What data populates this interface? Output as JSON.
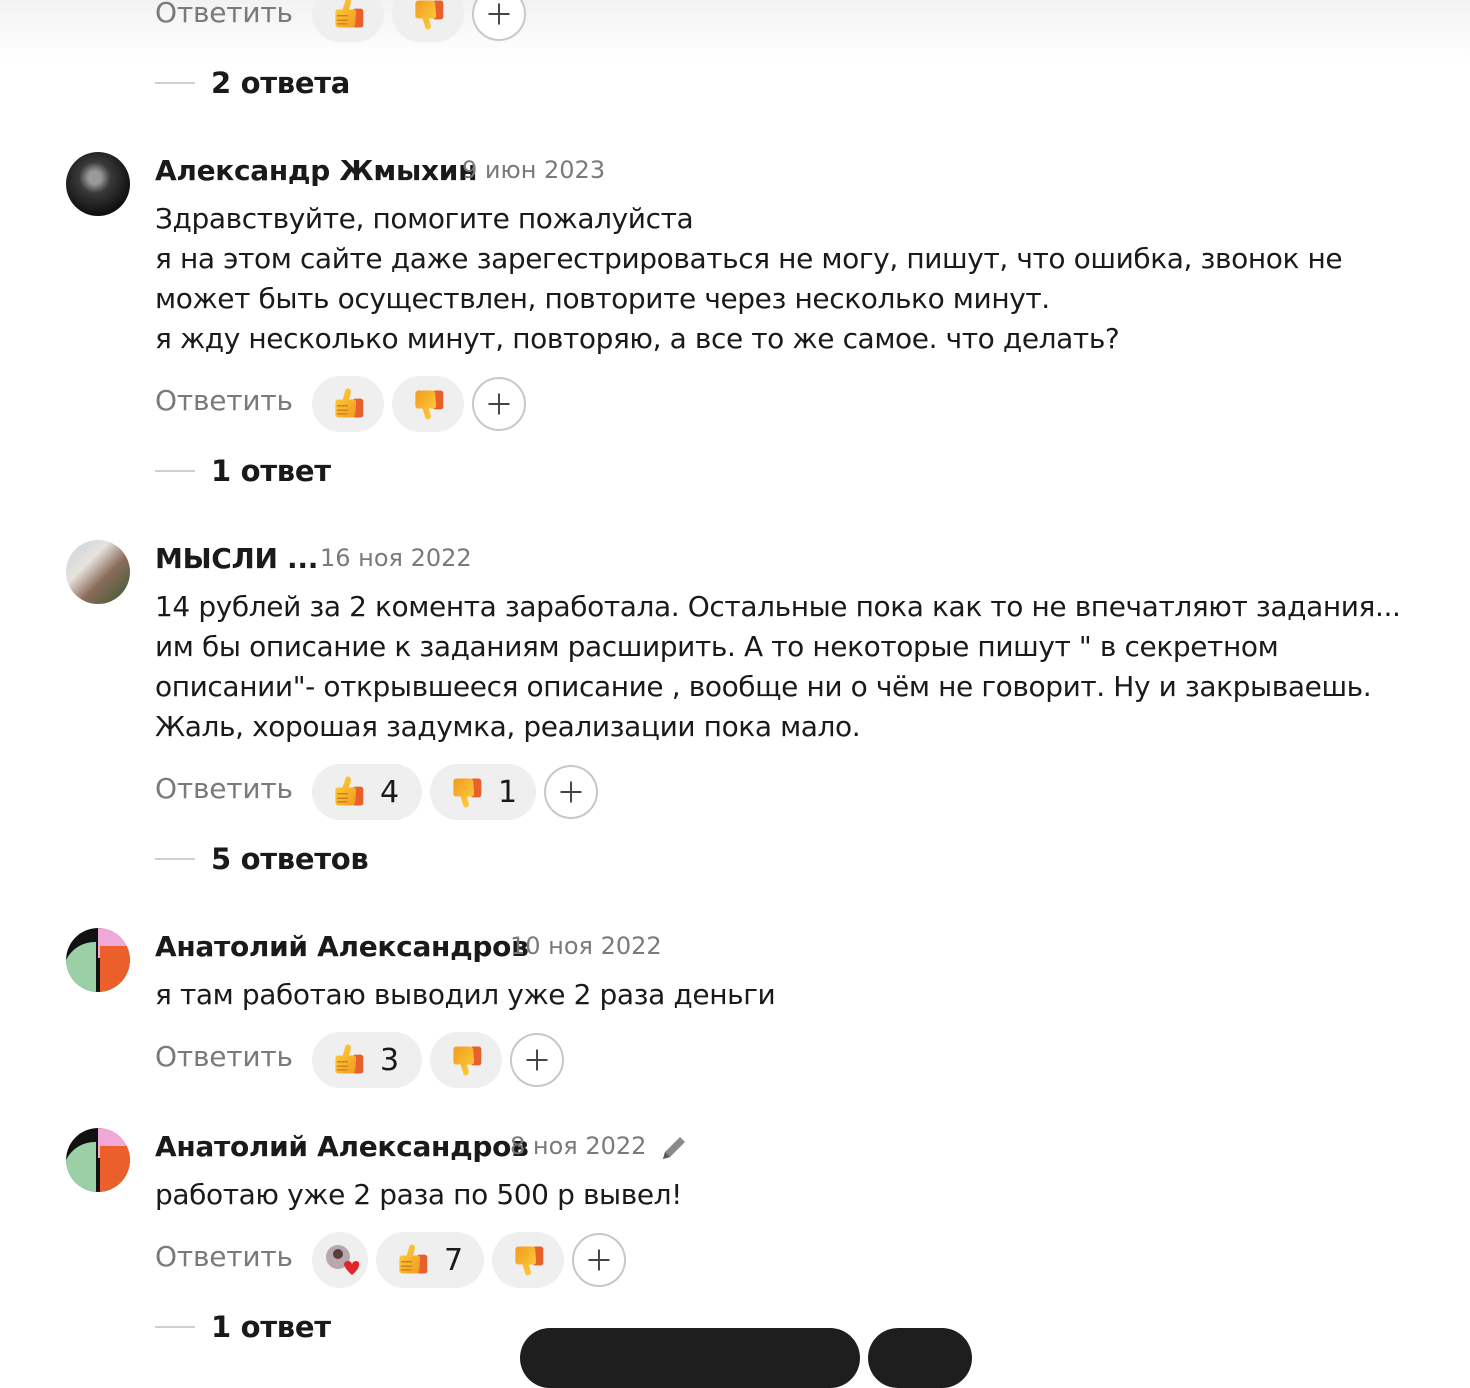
{
  "common": {
    "reply_label": "Ответить"
  },
  "top": {
    "thread_label": "2 ответа"
  },
  "comments": [
    {
      "author": "Александр Жмыхин",
      "date": "9 июн 2023",
      "lines": [
        "Здравствуйте, помогите пожалуйста",
        "я на этом сайте даже зарегестрироваться не могу, пишут, что ошибка, звонок не",
        "может быть осуществлен, повторите через несколько минут.",
        "я жду несколько минут, повторяю, а все то же самое. что делать?"
      ],
      "likes": "",
      "dislikes": "",
      "thread_label": "1 ответ"
    },
    {
      "author": "МЫСЛИ ...",
      "date": "16 ноя 2022",
      "lines": [
        "14 рублей за 2 комента заработала. Остальные пока как то не впечатляют задания...",
        "им бы описание к заданиям расширить. А то некоторые пишут \" в секретном",
        "описании\"- открывшееся описание , вообще ни о чём не говорит. Ну и закрываешь.",
        "Жаль, хорошая задумка, реализации пока мало."
      ],
      "likes": "4",
      "dislikes": "1",
      "thread_label": "5 ответов"
    },
    {
      "author": "Анатолий Александров",
      "date": "10 ноя 2022",
      "lines": [
        "я там работаю выводил уже 2 раза деньги"
      ],
      "likes": "3",
      "dislikes": ""
    },
    {
      "author": "Анатолий Александров",
      "date": "8 ноя 2022",
      "lines": [
        "работаю уже 2 раза по 500 р вывел!"
      ],
      "likes": "7",
      "dislikes": "",
      "thread_label": "1 ответ"
    }
  ],
  "icons": {
    "like": "thumbs-up-icon",
    "dislike": "thumbs-down-icon",
    "add_reaction": "plus-icon",
    "edited": "pencil-icon",
    "special_reaction": "heart-avatar-icon"
  },
  "colors": {
    "thumb_yellow": "#f6b92b",
    "thumb_orange": "#e8602c",
    "pill_bg": "#efefef",
    "muted_text": "#7a7a7a"
  }
}
